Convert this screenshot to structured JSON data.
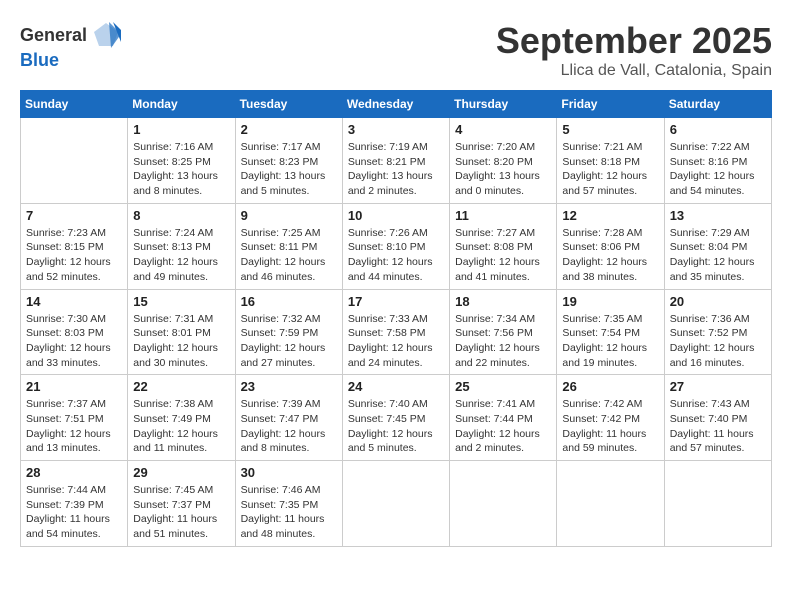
{
  "logo": {
    "general": "General",
    "blue": "Blue"
  },
  "header": {
    "month": "September 2025",
    "location": "Llica de Vall, Catalonia, Spain"
  },
  "weekdays": [
    "Sunday",
    "Monday",
    "Tuesday",
    "Wednesday",
    "Thursday",
    "Friday",
    "Saturday"
  ],
  "weeks": [
    [
      {
        "day": "",
        "info": ""
      },
      {
        "day": "1",
        "info": "Sunrise: 7:16 AM\nSunset: 8:25 PM\nDaylight: 13 hours and 8 minutes."
      },
      {
        "day": "2",
        "info": "Sunrise: 7:17 AM\nSunset: 8:23 PM\nDaylight: 13 hours and 5 minutes."
      },
      {
        "day": "3",
        "info": "Sunrise: 7:19 AM\nSunset: 8:21 PM\nDaylight: 13 hours and 2 minutes."
      },
      {
        "day": "4",
        "info": "Sunrise: 7:20 AM\nSunset: 8:20 PM\nDaylight: 13 hours and 0 minutes."
      },
      {
        "day": "5",
        "info": "Sunrise: 7:21 AM\nSunset: 8:18 PM\nDaylight: 12 hours and 57 minutes."
      },
      {
        "day": "6",
        "info": "Sunrise: 7:22 AM\nSunset: 8:16 PM\nDaylight: 12 hours and 54 minutes."
      }
    ],
    [
      {
        "day": "7",
        "info": "Sunrise: 7:23 AM\nSunset: 8:15 PM\nDaylight: 12 hours and 52 minutes."
      },
      {
        "day": "8",
        "info": "Sunrise: 7:24 AM\nSunset: 8:13 PM\nDaylight: 12 hours and 49 minutes."
      },
      {
        "day": "9",
        "info": "Sunrise: 7:25 AM\nSunset: 8:11 PM\nDaylight: 12 hours and 46 minutes."
      },
      {
        "day": "10",
        "info": "Sunrise: 7:26 AM\nSunset: 8:10 PM\nDaylight: 12 hours and 44 minutes."
      },
      {
        "day": "11",
        "info": "Sunrise: 7:27 AM\nSunset: 8:08 PM\nDaylight: 12 hours and 41 minutes."
      },
      {
        "day": "12",
        "info": "Sunrise: 7:28 AM\nSunset: 8:06 PM\nDaylight: 12 hours and 38 minutes."
      },
      {
        "day": "13",
        "info": "Sunrise: 7:29 AM\nSunset: 8:04 PM\nDaylight: 12 hours and 35 minutes."
      }
    ],
    [
      {
        "day": "14",
        "info": "Sunrise: 7:30 AM\nSunset: 8:03 PM\nDaylight: 12 hours and 33 minutes."
      },
      {
        "day": "15",
        "info": "Sunrise: 7:31 AM\nSunset: 8:01 PM\nDaylight: 12 hours and 30 minutes."
      },
      {
        "day": "16",
        "info": "Sunrise: 7:32 AM\nSunset: 7:59 PM\nDaylight: 12 hours and 27 minutes."
      },
      {
        "day": "17",
        "info": "Sunrise: 7:33 AM\nSunset: 7:58 PM\nDaylight: 12 hours and 24 minutes."
      },
      {
        "day": "18",
        "info": "Sunrise: 7:34 AM\nSunset: 7:56 PM\nDaylight: 12 hours and 22 minutes."
      },
      {
        "day": "19",
        "info": "Sunrise: 7:35 AM\nSunset: 7:54 PM\nDaylight: 12 hours and 19 minutes."
      },
      {
        "day": "20",
        "info": "Sunrise: 7:36 AM\nSunset: 7:52 PM\nDaylight: 12 hours and 16 minutes."
      }
    ],
    [
      {
        "day": "21",
        "info": "Sunrise: 7:37 AM\nSunset: 7:51 PM\nDaylight: 12 hours and 13 minutes."
      },
      {
        "day": "22",
        "info": "Sunrise: 7:38 AM\nSunset: 7:49 PM\nDaylight: 12 hours and 11 minutes."
      },
      {
        "day": "23",
        "info": "Sunrise: 7:39 AM\nSunset: 7:47 PM\nDaylight: 12 hours and 8 minutes."
      },
      {
        "day": "24",
        "info": "Sunrise: 7:40 AM\nSunset: 7:45 PM\nDaylight: 12 hours and 5 minutes."
      },
      {
        "day": "25",
        "info": "Sunrise: 7:41 AM\nSunset: 7:44 PM\nDaylight: 12 hours and 2 minutes."
      },
      {
        "day": "26",
        "info": "Sunrise: 7:42 AM\nSunset: 7:42 PM\nDaylight: 11 hours and 59 minutes."
      },
      {
        "day": "27",
        "info": "Sunrise: 7:43 AM\nSunset: 7:40 PM\nDaylight: 11 hours and 57 minutes."
      }
    ],
    [
      {
        "day": "28",
        "info": "Sunrise: 7:44 AM\nSunset: 7:39 PM\nDaylight: 11 hours and 54 minutes."
      },
      {
        "day": "29",
        "info": "Sunrise: 7:45 AM\nSunset: 7:37 PM\nDaylight: 11 hours and 51 minutes."
      },
      {
        "day": "30",
        "info": "Sunrise: 7:46 AM\nSunset: 7:35 PM\nDaylight: 11 hours and 48 minutes."
      },
      {
        "day": "",
        "info": ""
      },
      {
        "day": "",
        "info": ""
      },
      {
        "day": "",
        "info": ""
      },
      {
        "day": "",
        "info": ""
      }
    ]
  ]
}
